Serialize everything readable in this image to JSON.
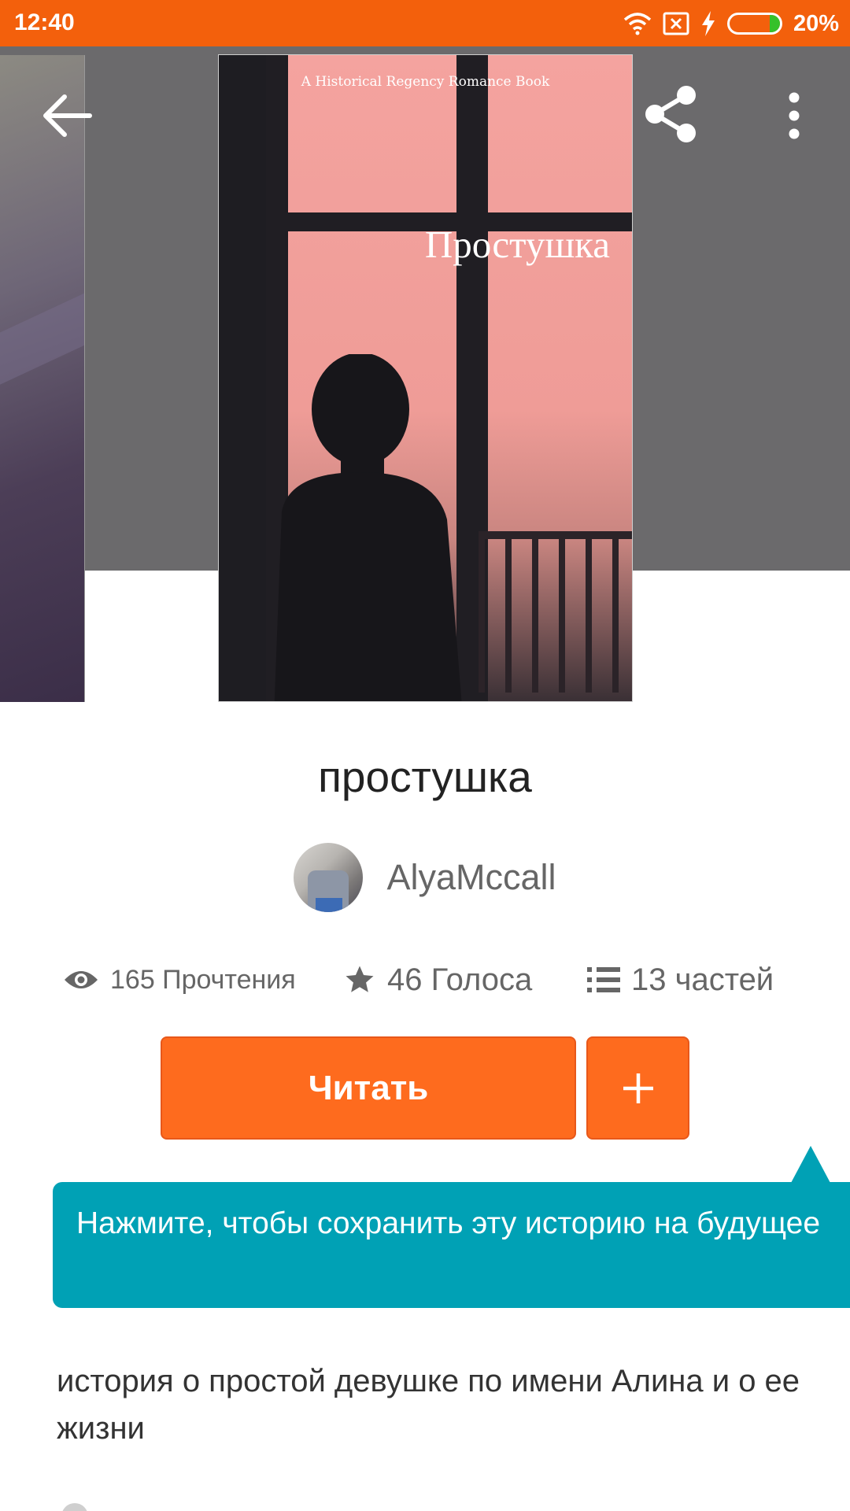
{
  "status_bar": {
    "time": "12:40",
    "battery_percent": "20%",
    "battery_level": 0.2,
    "color": "#f3600c"
  },
  "header": {
    "back_icon": "arrow-left-icon",
    "share_icon": "share-icon",
    "more_icon": "more-vertical-icon",
    "background": "#6b6a6c"
  },
  "cover": {
    "tagline": "A Historical Regency Romance Book",
    "title": "Простушка"
  },
  "story": {
    "title": "простушка",
    "author": "AlyaMccall",
    "reads": "165 Прочтения",
    "votes": "46 Голоса",
    "parts": "13 частей",
    "description": "история о простой девушке по имени Алина и о ее жизни"
  },
  "actions": {
    "read_label": "Читать",
    "add_icon": "plus-icon",
    "accent": "#fe6b1e"
  },
  "tooltip": {
    "text": "Нажмите, чтобы сохранить эту историю на будущее",
    "color": "#00a1b5"
  }
}
